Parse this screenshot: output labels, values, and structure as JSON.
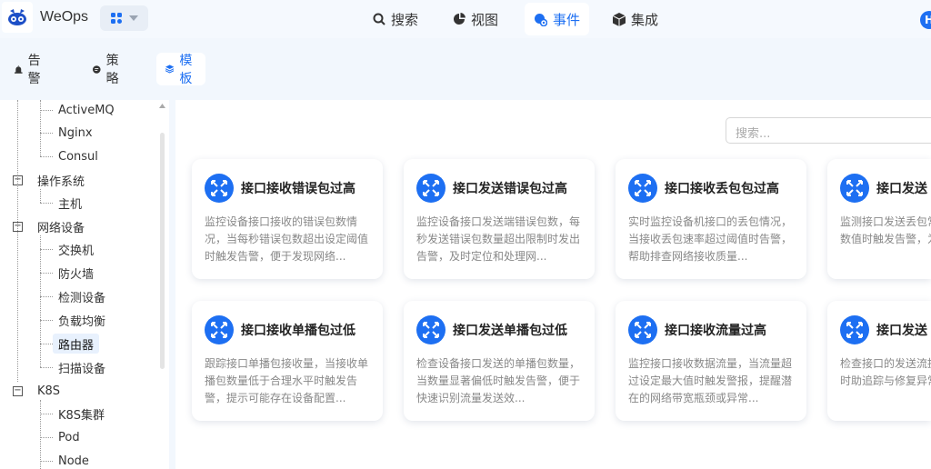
{
  "app": {
    "title": "WeOps"
  },
  "nav": [
    {
      "label": "搜索",
      "icon": "search-icon"
    },
    {
      "label": "视图",
      "icon": "pie-chart-icon"
    },
    {
      "label": "事件",
      "icon": "event-icon",
      "active": true
    },
    {
      "label": "集成",
      "icon": "cube-icon"
    }
  ],
  "avatar": {
    "letter": "H"
  },
  "subtabs": [
    {
      "label": "告警",
      "icon": "alarm-icon"
    },
    {
      "label": "策略",
      "icon": "policy-icon"
    },
    {
      "label": "模板",
      "icon": "layers-icon",
      "active": true
    }
  ],
  "tree": {
    "top_leaves": [
      "ActiveMQ",
      "Nginx",
      "Consul"
    ],
    "os": {
      "label": "操作系统",
      "toggle": "−",
      "children": [
        "主机"
      ]
    },
    "network": {
      "label": "网络设备",
      "toggle": "−",
      "children": [
        "交换机",
        "防火墙",
        "检测设备",
        "负载均衡",
        "路由器",
        "扫描设备"
      ],
      "selected": "路由器"
    },
    "k8s": {
      "label": "K8S",
      "toggle": "−",
      "children": [
        "K8S集群",
        "Pod",
        "Node"
      ]
    }
  },
  "search": {
    "placeholder": "搜索..."
  },
  "cards": [
    {
      "title": "接口接收错误包过高",
      "desc": "监控设备接口接收的错误包数情况，当每秒错误包数超出设定阈值时触发告警，便于发现网络..."
    },
    {
      "title": "接口发送错误包过高",
      "desc": "监控设备接口发送端错误包数，每秒发送错误包数量超出限制时发出告警，及时定位和处理网..."
    },
    {
      "title": "接口接收丢包包过高",
      "desc": "实时监控设备机接口的丢包情况，当接收丢包速率超过阈值时告警，帮助排查网络接收质量..."
    },
    {
      "title": "接口发送",
      "desc": "监测接口发送丢包常，当发送丢包数值时触发告警，为"
    },
    {
      "title": "接口接收单播包过低",
      "desc": "跟踪接口单播包接收量，当接收单播包数量低于合理水平时触发告警，提示可能存在设备配置..."
    },
    {
      "title": "接口发送单播包过低",
      "desc": "检查设备接口发送的单播包数量，当数量显著偏低时触发告警，便于快速识别流量发送效..."
    },
    {
      "title": "接口接收流量过高",
      "desc": "监控接口接收数据流量，当流量超过设定最大值时触发警报，提醒潜在的网络带宽瓶颈或异常..."
    },
    {
      "title": "接口发送",
      "desc": "检查接口的发送流据发送速率过高时助追踪与修复异常"
    }
  ]
}
